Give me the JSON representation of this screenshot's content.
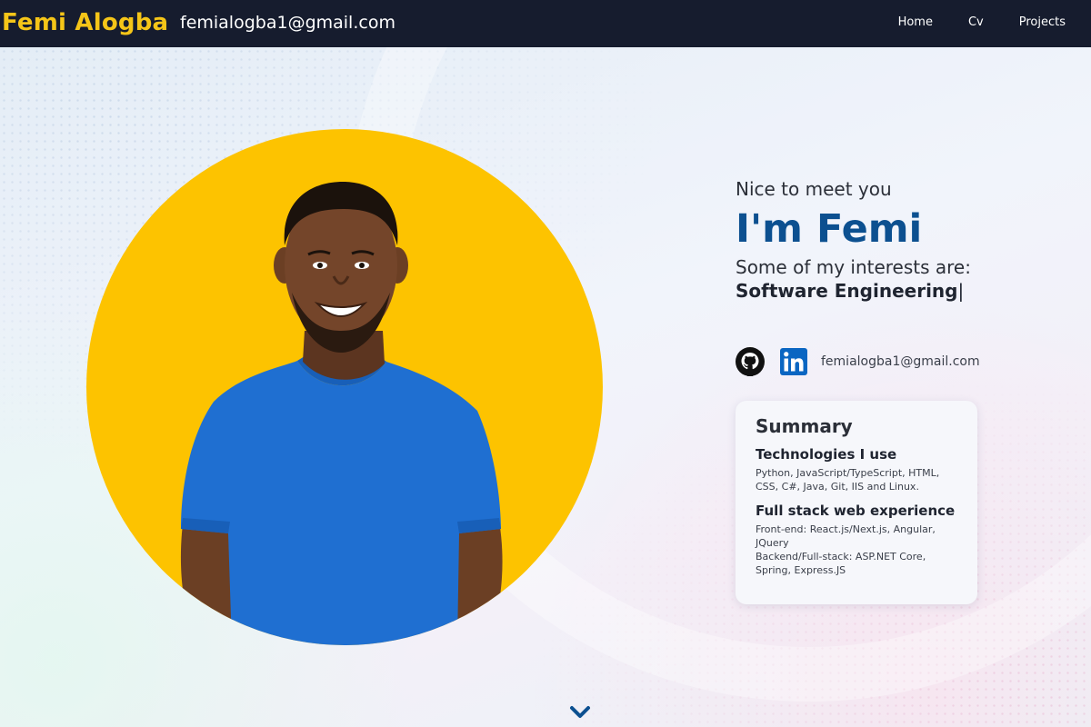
{
  "header": {
    "brand": "Femi Alogba",
    "email": "femialogba1@gmail.com",
    "nav": [
      {
        "label": "Home"
      },
      {
        "label": "Cv"
      },
      {
        "label": "Projects"
      }
    ]
  },
  "hero": {
    "greeting": "Nice to meet you",
    "name_heading": "I'm Femi",
    "interests_label": "Some of my interests are:",
    "interest_value": "Software Engineering",
    "cursor": "|",
    "portrait_background": "#fdc300"
  },
  "socials": {
    "icons": [
      "github-icon",
      "linkedin-icon"
    ],
    "email": "femialogba1@gmail.com"
  },
  "summary": {
    "title": "Summary",
    "sections": [
      {
        "title": "Technologies I use",
        "lines": [
          "Python, JavaScript/TypeScript, HTML, CSS, C#, Java, Git, IIS and Linux."
        ]
      },
      {
        "title": "Full stack web experience",
        "lines": [
          "Front-end: React.js/Next.js, Angular, JQuery",
          "Backend/Full-stack: ASP.NET Core, Spring, Express.JS"
        ]
      }
    ]
  },
  "scroll": {
    "icon": "chevron-down-icon"
  },
  "colors": {
    "nav_background": "#161c2e",
    "brand": "#f5c518",
    "heading": "#0c5090",
    "portrait_circle": "#fdc300",
    "shirt": "#1f6fd1"
  }
}
